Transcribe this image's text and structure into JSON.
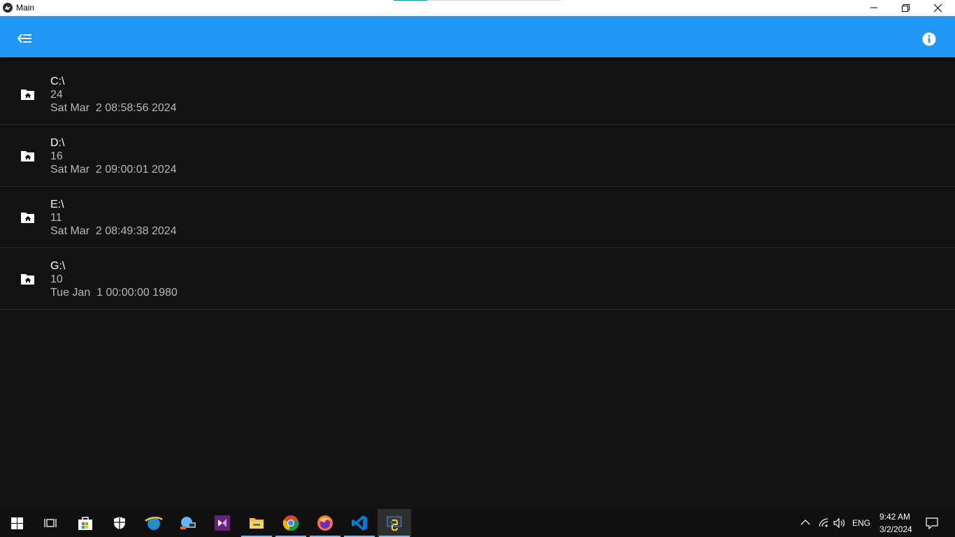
{
  "window": {
    "title": "Main"
  },
  "appbar": {
    "back_icon": "back-menu-icon",
    "info_icon": "info-icon",
    "color": "#2196F3"
  },
  "drives": [
    {
      "name": "C:\\",
      "count": "24",
      "modified": "Sat Mar  2 08:58:56 2024",
      "icon": "folder-home-icon"
    },
    {
      "name": "D:\\",
      "count": "16",
      "modified": "Sat Mar  2 09:00:01 2024",
      "icon": "folder-home-icon"
    },
    {
      "name": "E:\\",
      "count": "11",
      "modified": "Sat Mar  2 08:49:38 2024",
      "icon": "folder-home-icon"
    },
    {
      "name": "G:\\",
      "count": "10",
      "modified": "Tue Jan  1 00:00:00 1980",
      "icon": "folder-home-icon"
    }
  ],
  "taskbar": {
    "items": [
      "start-icon",
      "task-view-icon",
      "store-icon",
      "security-icon",
      "globe-app-icon",
      "network-app-icon",
      "visual-studio-icon",
      "file-explorer-icon",
      "chrome-icon",
      "firefox-icon",
      "vscode-icon",
      "python-icon"
    ],
    "language": "ENG",
    "time": "9:42 AM",
    "date": "3/2/2024"
  }
}
